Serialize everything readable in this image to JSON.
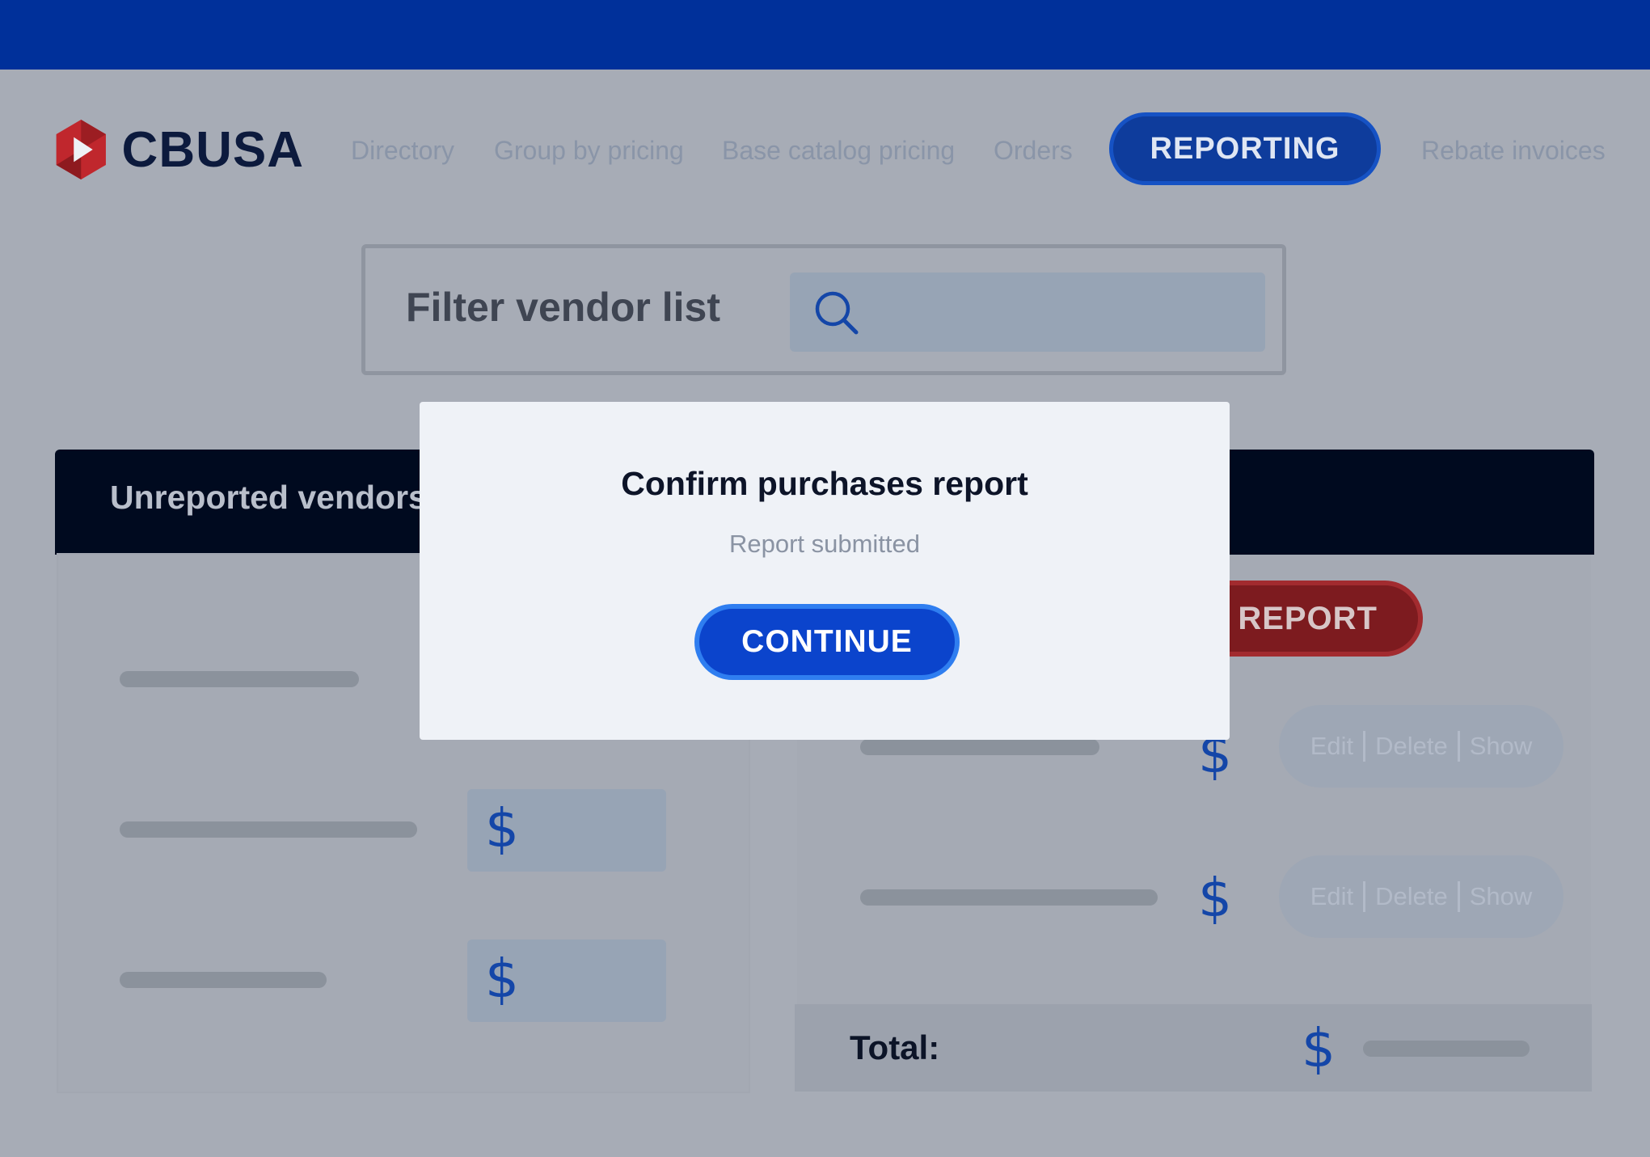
{
  "brand": {
    "name": "CBUSA"
  },
  "nav": {
    "items": [
      "Directory",
      "Group by pricing",
      "Base catalog pricing",
      "Orders",
      "REPORTING",
      "Rebate invoices"
    ],
    "active": "REPORTING"
  },
  "filter": {
    "label": "Filter vendor list",
    "value": ""
  },
  "panel": {
    "title": "Unreported vendors"
  },
  "currency_symbol": "$",
  "report_button": "REPORT",
  "row_actions": {
    "edit": "Edit",
    "delete": "Delete",
    "show": "Show"
  },
  "total": {
    "label": "Total:"
  },
  "modal": {
    "title": "Confirm purchases report",
    "subtitle": "Report submitted",
    "button": "CONTINUE"
  },
  "colors": {
    "brand_blue": "#00309a",
    "accent_blue": "#0b44cc",
    "report_red": "#7d1b1f",
    "logo_red": "#c0272d"
  }
}
